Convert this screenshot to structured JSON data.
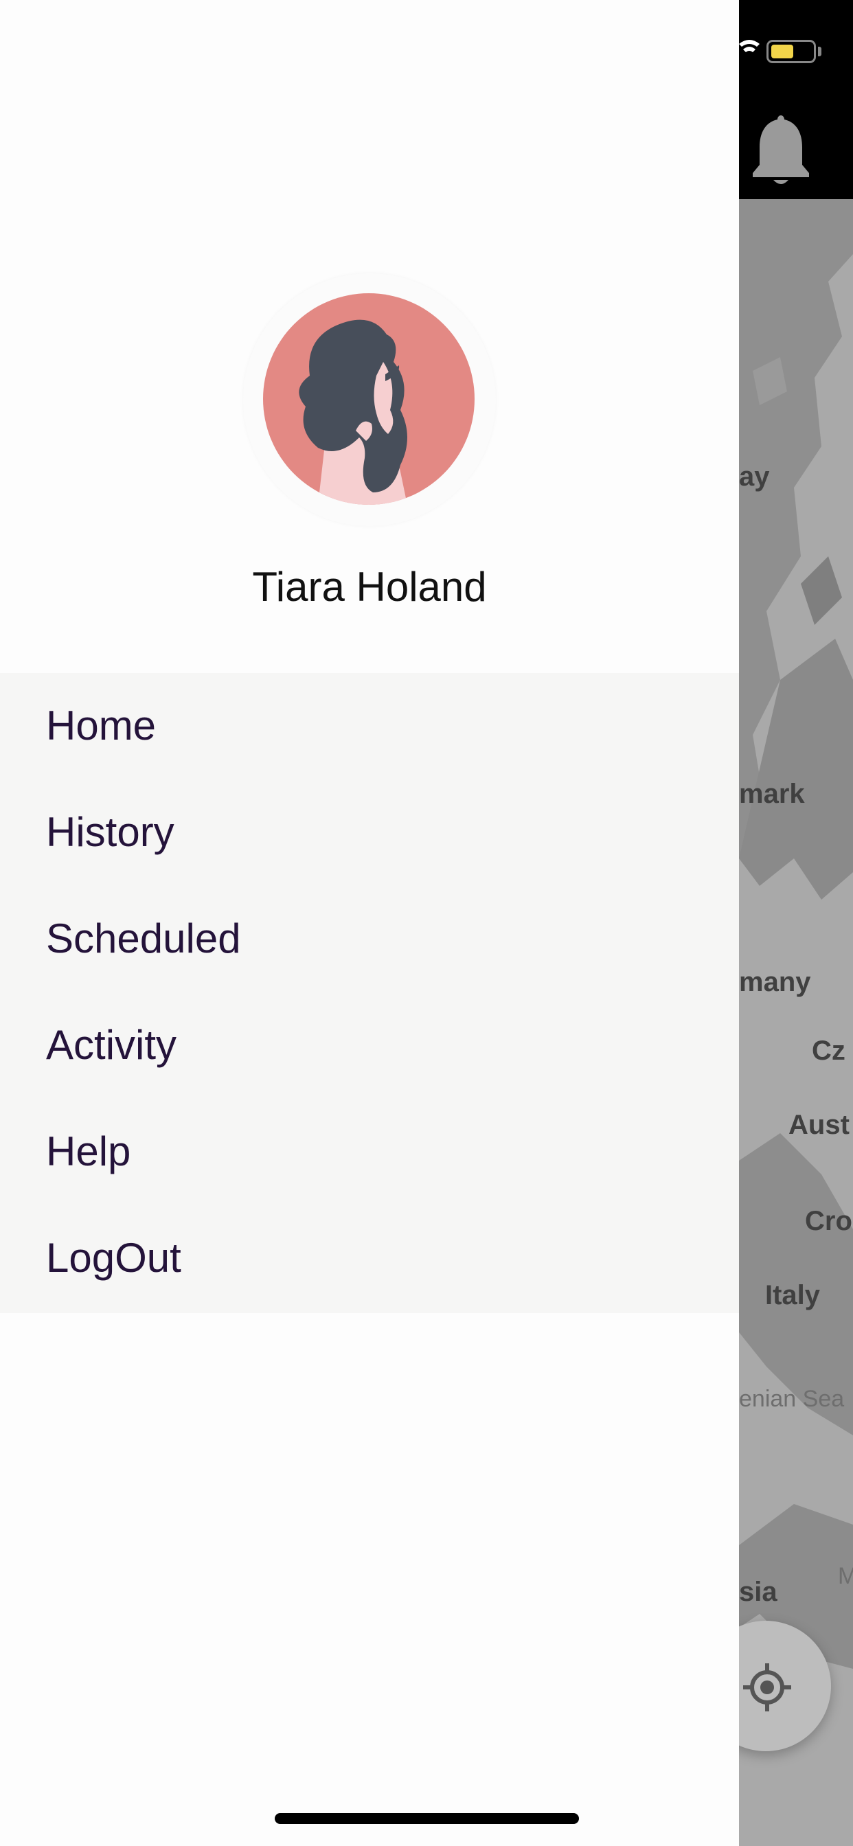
{
  "drawer": {
    "user_name": "Tiara Holand",
    "menu": [
      {
        "label": "Home"
      },
      {
        "label": "History"
      },
      {
        "label": "Scheduled"
      },
      {
        "label": "Activity"
      },
      {
        "label": "Help"
      },
      {
        "label": "LogOut"
      }
    ]
  },
  "map": {
    "labels": [
      "ay",
      "mark",
      "many",
      "Cz",
      "Aust",
      "Cro",
      "Italy",
      "enian Sea",
      "sia",
      "M"
    ]
  },
  "status": {
    "battery_level": 0.55
  },
  "colors": {
    "avatar_bg": "#e38984",
    "menu_bg": "#f6f6f5",
    "menu_text": "#24133a",
    "map_bg": "#a9a9a9",
    "battery": "#f2d54a"
  },
  "icons": [
    "wifi-icon",
    "battery-icon",
    "bell-icon",
    "locate-icon"
  ]
}
